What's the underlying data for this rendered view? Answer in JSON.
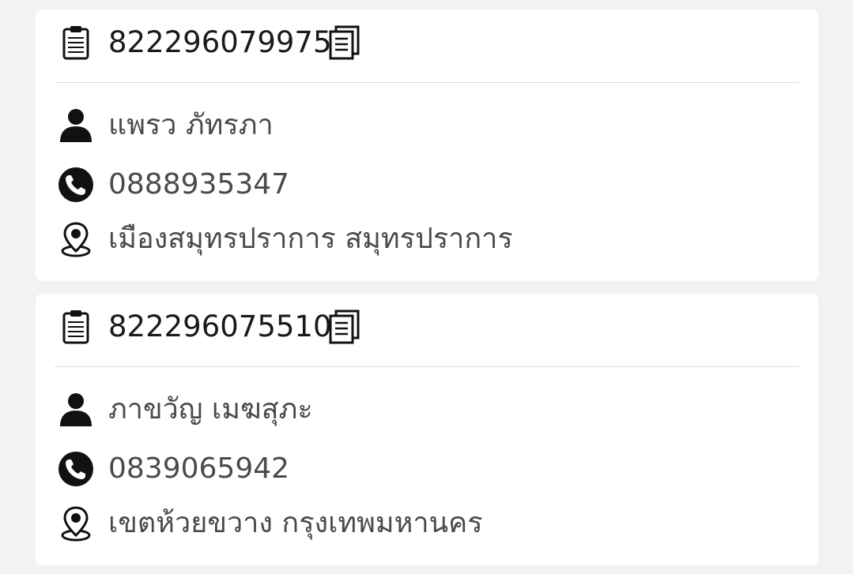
{
  "orders": [
    {
      "order_number": "822296079975",
      "customer_name": "แพรว ภัทรภา",
      "phone": "0888935347",
      "address": "เมืองสมุทรปราการ สมุทรปราการ"
    },
    {
      "order_number": "822296075510",
      "customer_name": "ภาขวัญ เมฆสุภะ",
      "phone": "0839065942",
      "address": "เขตห้วยขวาง กรุงเทพมหานคร"
    }
  ],
  "icons": {
    "clipboard": "clipboard-icon",
    "copy": "copy-icon",
    "person": "person-icon",
    "phone": "phone-icon",
    "location": "location-pin-icon"
  },
  "colors": {
    "background": "#f2f2f2",
    "card": "#ffffff",
    "primary_text": "#1a1a1a",
    "secondary_text": "#4a4a4a",
    "divider": "#dcdcdc"
  }
}
